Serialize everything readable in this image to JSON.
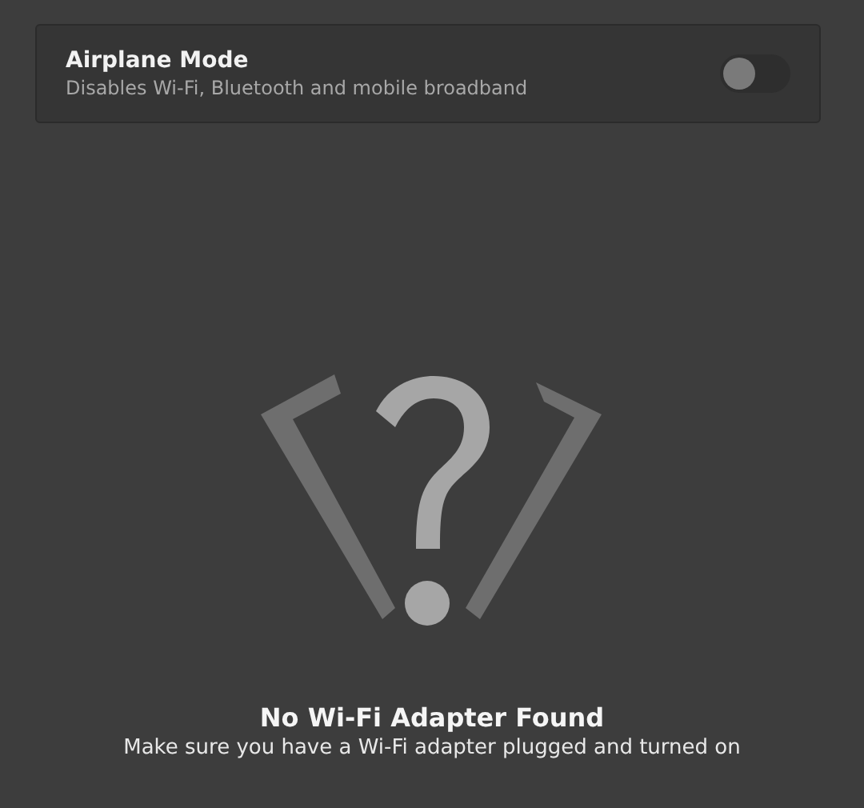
{
  "airplane_mode": {
    "title": "Airplane Mode",
    "description": "Disables Wi-Fi, Bluetooth and mobile broadband",
    "on": false
  },
  "empty_state": {
    "title": "No Wi-Fi Adapter Found",
    "message": "Make sure you have a Wi-Fi adapter plugged and turned on"
  }
}
